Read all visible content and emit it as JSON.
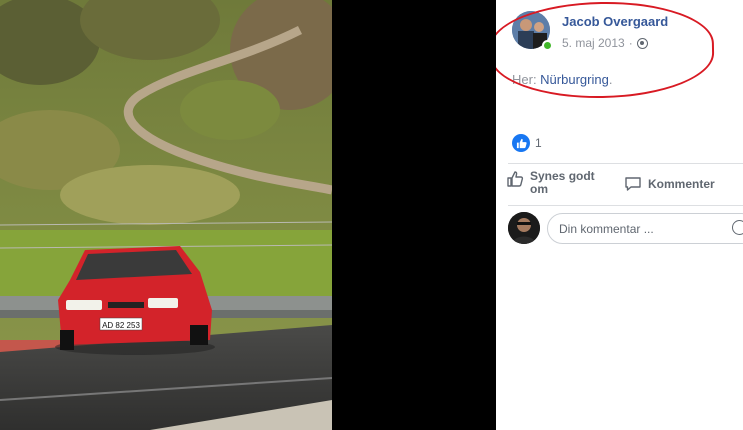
{
  "post": {
    "author": "Jacob Overgaard",
    "date": "5. maj 2013",
    "separator": "·",
    "privacy_icon": "globe-icon",
    "text_prefix": "Her: ",
    "place": "Nürburgring",
    "text_suffix": "."
  },
  "reactions": {
    "icon": "thumbs-up-icon",
    "count": "1"
  },
  "actions": {
    "like_label": "Synes godt om",
    "comment_label": "Kommenter"
  },
  "comment": {
    "placeholder": "Din kommentar ..."
  },
  "photo": {
    "plate": "AD 82 253"
  },
  "colors": {
    "link": "#365899",
    "annotation": "#d81a23",
    "like_blue": "#1877f2",
    "online": "#42b72a"
  }
}
